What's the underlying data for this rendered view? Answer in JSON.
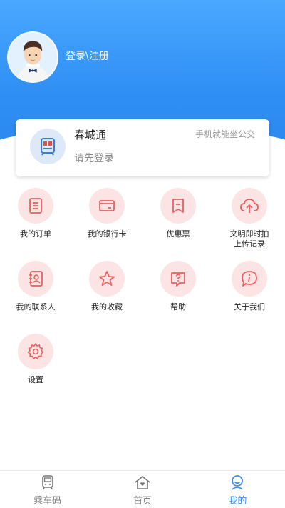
{
  "header": {
    "login_label": "登录\\注册"
  },
  "card": {
    "title": "春城通",
    "slogan": "手机就能坐公交",
    "subtitle": "请先登录"
  },
  "menu": [
    {
      "label": "我的订单",
      "icon": "order-icon"
    },
    {
      "label": "我的银行卡",
      "icon": "bank-card-icon"
    },
    {
      "label": "优惠票",
      "icon": "coupon-icon"
    },
    {
      "label": "文明即时拍\n上传记录",
      "icon": "cloud-upload-icon"
    },
    {
      "label": "我的联系人",
      "icon": "contacts-icon"
    },
    {
      "label": "我的收藏",
      "icon": "star-icon"
    },
    {
      "label": "帮助",
      "icon": "help-icon"
    },
    {
      "label": "关于我们",
      "icon": "info-icon"
    },
    {
      "label": "设置",
      "icon": "gear-icon"
    }
  ],
  "tabs": [
    {
      "label": "乘车码",
      "icon": "bus-icon",
      "active": false
    },
    {
      "label": "首页",
      "icon": "home-icon",
      "active": false
    },
    {
      "label": "我的",
      "icon": "person-icon",
      "active": true
    }
  ],
  "colors": {
    "accent": "#3a8ff0",
    "icon_red": "#e86060",
    "icon_bg": "#fde4e4"
  }
}
